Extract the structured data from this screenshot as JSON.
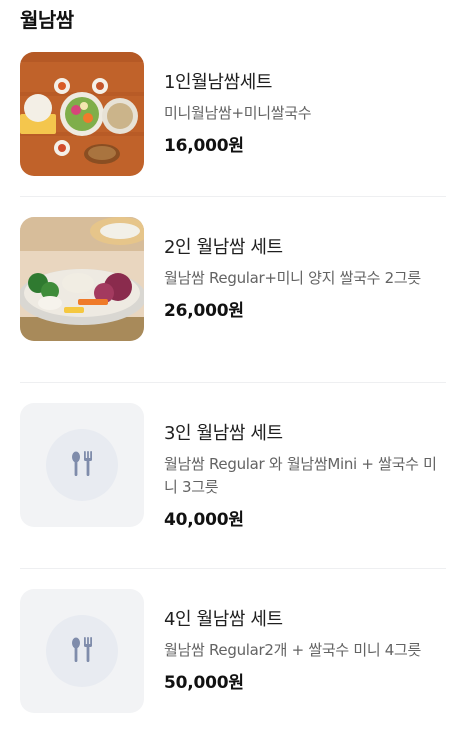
{
  "section": {
    "title": "월남쌈"
  },
  "items": [
    {
      "name": "1인월남쌈세트",
      "desc": "미니월남쌈+미니쌀국수",
      "price": "16,000원",
      "image": "photo-set-1"
    },
    {
      "name": "2인 월남쌈 세트",
      "desc": "월남쌈 Regular+미니 양지 쌀국수 2그릇",
      "price": "26,000원",
      "image": "photo-set-2"
    },
    {
      "name": "3인 월남쌈 세트",
      "desc": "월남쌈 Regular 와 월남쌈Mini + 쌀국수 미니 3그릇",
      "price": "40,000원",
      "image": "fork-spoon-icon"
    },
    {
      "name": "4인 월남쌈 세트",
      "desc": "월남쌈 Regular2개 + 쌀국수 미니 4그릇",
      "price": "50,000원",
      "image": "fork-spoon-icon"
    }
  ],
  "colors": {
    "placeholder_bg": "#f2f3f5",
    "placeholder_circle": "#e8ebf1",
    "utensil": "#7f8cab"
  }
}
